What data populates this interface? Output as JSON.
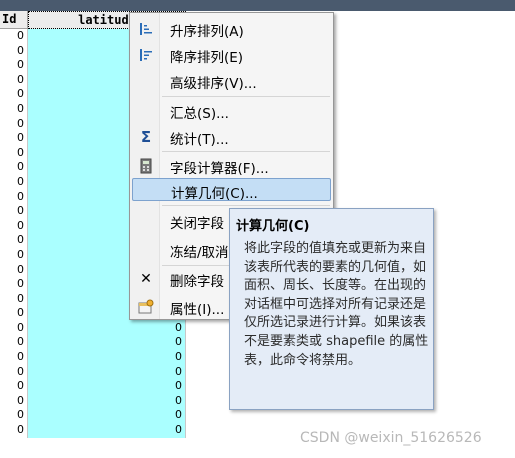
{
  "grid": {
    "columns": [
      "Id",
      "latitude"
    ],
    "rows": [
      "0",
      "0",
      "0",
      "0",
      "0",
      "0",
      "0",
      "0",
      "0",
      "0",
      "0",
      "0",
      "0",
      "0",
      "0",
      "0",
      "0",
      "0",
      "0",
      "0",
      "0",
      "0",
      "0",
      "0",
      "0",
      "0",
      "0",
      "0"
    ],
    "colors": {
      "selected_column": "#aaffff"
    }
  },
  "menu": {
    "items": [
      {
        "label": "升序排列(A)",
        "icon": "sort-ascending-icon"
      },
      {
        "label": "降序排列(E)",
        "icon": "sort-descending-icon"
      },
      {
        "label": "高级排序(V)...",
        "icon": ""
      },
      {
        "label": "汇总(S)...",
        "icon": ""
      },
      {
        "label": "统计(T)...",
        "icon": "sigma-icon"
      },
      {
        "label": "字段计算器(F)...",
        "icon": "calculator-icon"
      },
      {
        "label": "计算几何(C)...",
        "icon": ""
      },
      {
        "label": "关闭字段",
        "icon": ""
      },
      {
        "label": "冻结/取消",
        "icon": ""
      },
      {
        "label": "删除字段",
        "icon": "delete-icon"
      },
      {
        "label": "属性(I)...",
        "icon": "properties-icon"
      }
    ],
    "highlighted_index": 6,
    "colors": {
      "highlight": "#c4def5"
    }
  },
  "tooltip": {
    "title": "计算几何(C)",
    "body": "将此字段的值填充或更新为来自该表所代表的要素的几何值，如面积、周长、长度等。在出现的对话框中可选择对所有记录还是仅所选记录进行计算。如果该表不是要素类或 shapefile 的属性表，此命令将禁用。"
  },
  "watermark": "CSDN @weixin_51626526"
}
